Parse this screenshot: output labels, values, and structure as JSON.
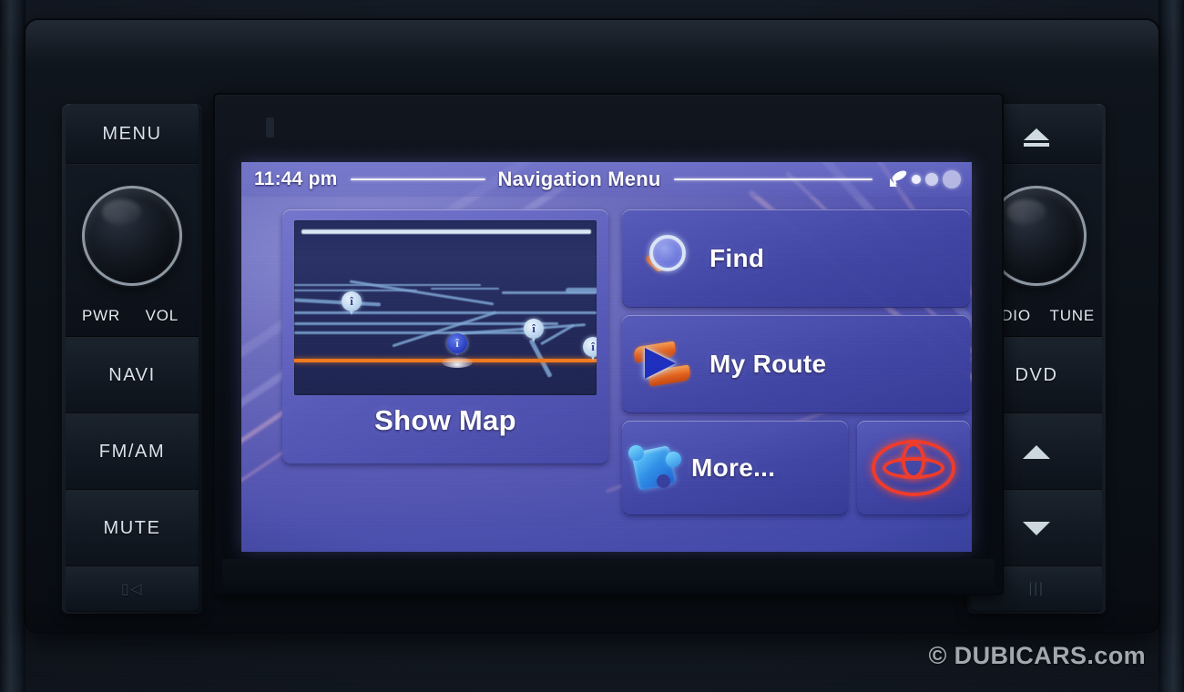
{
  "device": {
    "brand": "Toyota",
    "watermark": "© DUBICARS.com"
  },
  "screen": {
    "status_bar": {
      "clock": "11:44 pm",
      "title": "Navigation Menu",
      "gps_icon": "satellite-dish-icon",
      "signal_dots": 3
    },
    "tiles": {
      "show_map": {
        "label": "Show Map",
        "preview_name": "map-preview",
        "route_color": "#f07a1e",
        "road_color": "#9fc3e8",
        "map_bg": "#232b5e",
        "pins": 4
      },
      "find": {
        "label": "Find",
        "icon": "magnifier-icon"
      },
      "my_route": {
        "label": "My Route",
        "icon": "route-arrow-icon"
      },
      "more": {
        "label": "More...",
        "icon": "puzzle-piece-icon"
      },
      "toyota": {
        "icon": "toyota-logo-icon",
        "color": "#ef3b2a"
      }
    },
    "colors": {
      "wallpaper": "#5a5ab4",
      "tile": "#404aa4",
      "text": "#ffffff"
    }
  },
  "hardware": {
    "left": {
      "menu": "MENU",
      "knob_left_label": "PWR",
      "knob_right_label": "VOL",
      "navi": "NAVI",
      "fmam": "FM/AM",
      "mute": "MUTE",
      "bottom_icon": "display-off-icon"
    },
    "right": {
      "eject": "eject-icon",
      "knob_left_label": "AUDIO",
      "knob_right_label": "TUNE",
      "dvd": "DVD",
      "seek_up": "chevron-up-icon",
      "seek_down": "chevron-down-icon"
    }
  }
}
